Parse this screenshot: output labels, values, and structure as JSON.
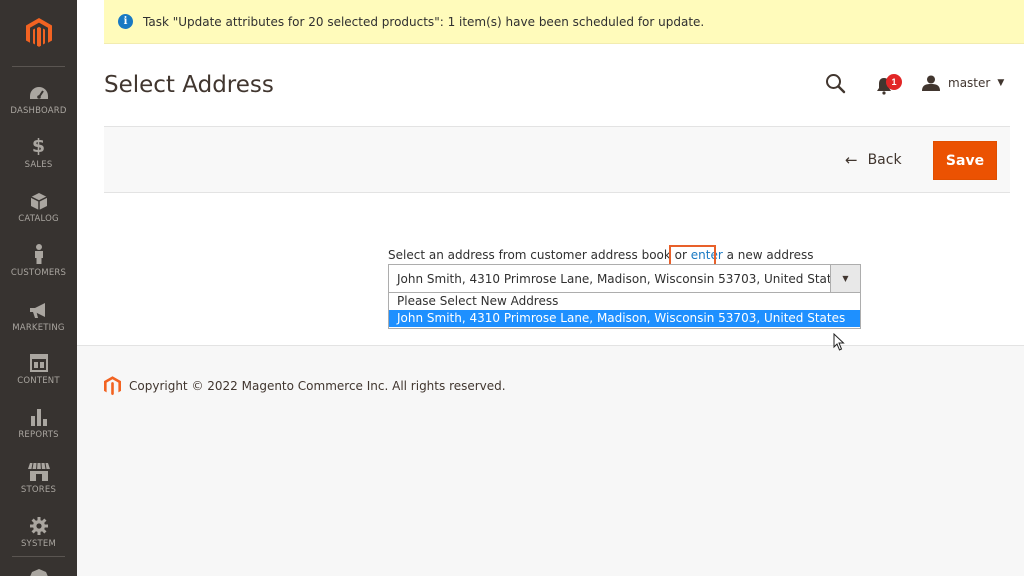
{
  "sidebar": {
    "items": [
      {
        "label": "DASHBOARD",
        "icon": "dashboard-icon"
      },
      {
        "label": "SALES",
        "icon": "dollar-icon"
      },
      {
        "label": "CATALOG",
        "icon": "box-icon"
      },
      {
        "label": "CUSTOMERS",
        "icon": "person-icon"
      },
      {
        "label": "MARKETING",
        "icon": "megaphone-icon"
      },
      {
        "label": "CONTENT",
        "icon": "layout-icon"
      },
      {
        "label": "REPORTS",
        "icon": "bar-chart-icon"
      },
      {
        "label": "STORES",
        "icon": "storefront-icon"
      },
      {
        "label": "SYSTEM",
        "icon": "gear-icon"
      }
    ]
  },
  "message": {
    "text": "Task \"Update attributes for 20 selected products\": 1 item(s) have been scheduled for update.",
    "icon": "info-icon"
  },
  "header": {
    "title": "Select Address",
    "notification_count": "1",
    "user_name": "master"
  },
  "actions": {
    "back_label": "Back",
    "save_label": "Save"
  },
  "address": {
    "label_before": "Select an address from customer address book or ",
    "label_link": "enter",
    "label_after": " a new address",
    "selected_value": "John Smith, 4310 Primrose Lane, Madison, Wisconsin 53703, United States",
    "options": [
      "Please Select New Address",
      "John Smith, 4310 Primrose Lane, Madison, Wisconsin 53703, United States"
    ]
  },
  "footer": {
    "copyright": "Copyright © 2022 Magento Commerce Inc. All rights reserved."
  },
  "colors": {
    "sidebar_bg": "#373330",
    "brand_orange": "#eb5202",
    "link_blue": "#1979c3",
    "message_bg": "#fffbbb",
    "option_selected_bg": "#1e90ff"
  }
}
